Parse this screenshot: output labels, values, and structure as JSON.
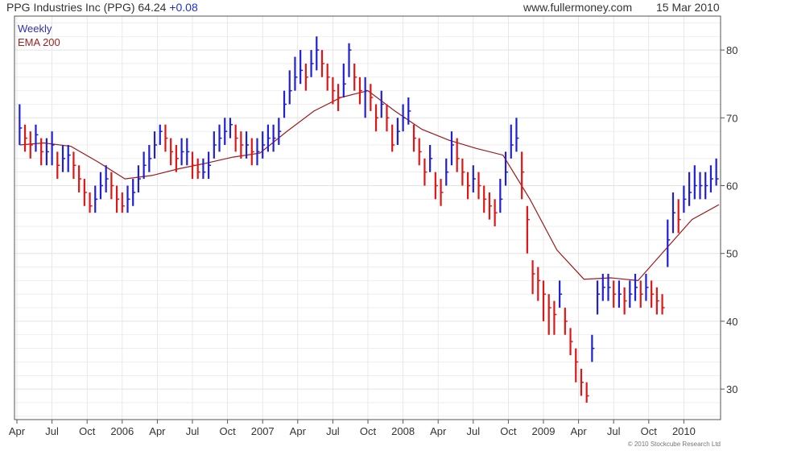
{
  "header": {
    "title": "PPG Industries Inc (PPG)",
    "last": "64.24",
    "change": "+0.08",
    "site": "www.fullermoney.com",
    "date": "15 Mar 2010"
  },
  "colors": {
    "up": "#1f1fd6",
    "down": "#e01616",
    "ema": "#9e1a1a",
    "grid": "#e3e3e3",
    "axis": "#555555"
  },
  "chart_data": {
    "type": "line",
    "title": "PPG Industries Inc (PPG)",
    "ylim": [
      25.5,
      85
    ],
    "y_ticks": [
      30,
      40,
      50,
      60,
      70,
      80
    ],
    "x_ticks": [
      "Apr",
      "Jul",
      "Oct",
      "2006",
      "Apr",
      "Jul",
      "Oct",
      "2007",
      "Apr",
      "Jul",
      "Oct",
      "2008",
      "Apr",
      "Jul",
      "Oct",
      "2009",
      "Apr",
      "Jul",
      "Oct",
      "2010"
    ],
    "grid": true,
    "legend": [
      "Weekly",
      "EMA 200"
    ],
    "legend_position": "top-left",
    "series": [
      {
        "name": "Weekly",
        "kind": "price-bars",
        "x": [
          1,
          3,
          5,
          7,
          9,
          11,
          13,
          15,
          17,
          19,
          21,
          23,
          25,
          27,
          29,
          31,
          33,
          35,
          37,
          39,
          41,
          43,
          45,
          47,
          49,
          51,
          53,
          55,
          57,
          59,
          61,
          63,
          65,
          67,
          69,
          71,
          73,
          75,
          77,
          79,
          81,
          83,
          85,
          87,
          89,
          91,
          93,
          95,
          97,
          99,
          101,
          103,
          105,
          107,
          109,
          111,
          113,
          115,
          117,
          119,
          121,
          123,
          125,
          127,
          129,
          131,
          133,
          135,
          137,
          139,
          141,
          143,
          145,
          147,
          149,
          151,
          153,
          155,
          157,
          159,
          161,
          163,
          165,
          167,
          169,
          171,
          173,
          175,
          177,
          179,
          181,
          183,
          185,
          187,
          189,
          191,
          193,
          195,
          197,
          199,
          201,
          203,
          205,
          207,
          209,
          211,
          213,
          215,
          217,
          219,
          221,
          223,
          225,
          227,
          229,
          231,
          233,
          235,
          237,
          239,
          241,
          243,
          245,
          247,
          249,
          251,
          253,
          255,
          257,
          259
        ],
        "values": [
          68.5,
          67,
          66,
          67.5,
          65,
          65,
          66,
          63,
          64,
          64.5,
          63,
          61,
          59,
          57,
          58,
          60,
          61,
          60,
          58,
          57,
          58,
          59,
          61,
          63,
          64,
          66,
          68,
          67,
          65,
          64,
          65,
          65,
          63,
          62,
          62,
          63,
          66,
          67,
          68,
          69,
          67,
          66,
          66,
          65,
          65,
          66,
          67,
          67,
          68,
          72,
          74,
          76,
          77,
          76,
          78,
          80,
          78,
          76,
          74,
          73,
          75,
          80,
          76,
          74,
          74,
          73,
          70,
          72,
          70,
          66,
          68,
          70,
          71,
          67,
          65,
          62,
          64,
          60,
          59,
          62,
          66,
          64,
          62,
          60,
          61,
          60,
          58,
          57,
          56,
          58,
          62,
          66,
          67,
          62,
          55,
          47,
          46,
          44,
          42,
          41,
          44,
          40,
          37,
          34,
          31,
          29,
          36,
          44,
          45,
          45,
          44,
          44,
          43,
          44,
          45,
          44,
          45,
          44,
          43,
          42,
          52,
          56,
          55,
          58,
          59,
          60,
          60,
          60,
          61,
          61
        ],
        "high": [
          72,
          69,
          68,
          69,
          67,
          67,
          68,
          65,
          66,
          66,
          65,
          63,
          61,
          59,
          60,
          62,
          63,
          62,
          60,
          59,
          60,
          61,
          63,
          65,
          66,
          68,
          69,
          69,
          67,
          66,
          67,
          67,
          65,
          64,
          64,
          65,
          68,
          69,
          70,
          70,
          69,
          68,
          68,
          67,
          67,
          68,
          69,
          69,
          70,
          74,
          77,
          79,
          80,
          78,
          80,
          82,
          80,
          78,
          76,
          75,
          78,
          81,
          78,
          76,
          76,
          75,
          72,
          74,
          72,
          69,
          70,
          72,
          73,
          69,
          67,
          64,
          66,
          62,
          61,
          64,
          68,
          67,
          64,
          62,
          63,
          62,
          60,
          59,
          58,
          61,
          65,
          69,
          70,
          65,
          57,
          49,
          48,
          46,
          44,
          43,
          46,
          42,
          39,
          36,
          33,
          31,
          38,
          46,
          47,
          47,
          46,
          46,
          45,
          46,
          47,
          46,
          47,
          46,
          45,
          44,
          55,
          59,
          58,
          60,
          62,
          63,
          62,
          62,
          63,
          64
        ],
        "low": [
          66,
          65,
          64,
          65,
          63,
          63,
          63,
          61,
          62,
          62,
          61,
          59,
          57,
          56,
          56,
          58,
          59,
          58,
          56,
          56,
          56,
          57,
          59,
          61,
          62,
          64,
          66,
          65,
          63,
          62,
          63,
          63,
          61,
          61,
          61,
          61,
          64,
          65,
          66,
          67,
          65,
          64,
          64,
          63,
          63,
          64,
          65,
          65,
          66,
          70,
          72,
          74,
          75,
          74,
          76,
          77,
          76,
          74,
          72,
          71,
          73,
          76,
          74,
          72,
          70,
          71,
          68,
          70,
          68,
          65,
          66,
          68,
          69,
          65,
          63,
          60,
          62,
          58,
          57,
          60,
          63,
          62,
          60,
          58,
          59,
          58,
          56,
          55,
          54,
          56,
          60,
          64,
          65,
          58,
          50,
          44,
          43,
          40,
          38,
          38,
          42,
          38,
          35,
          31,
          29,
          28,
          34,
          41,
          43,
          43,
          42,
          42,
          41,
          42,
          43,
          42,
          43,
          42,
          41,
          41,
          48,
          53,
          53,
          56,
          57,
          58,
          58,
          58,
          59,
          60
        ]
      },
      {
        "name": "EMA 200",
        "kind": "line",
        "x": [
          1,
          10,
          20,
          30,
          40,
          50,
          60,
          70,
          80,
          90,
          100,
          110,
          120,
          130,
          140,
          150,
          160,
          170,
          180,
          190,
          200,
          210,
          220,
          230,
          240,
          250,
          260
        ],
        "values": [
          66,
          66.3,
          65.8,
          63.5,
          61,
          61.5,
          62.5,
          63.3,
          64.2,
          64.8,
          68,
          71,
          73,
          74,
          71,
          68.3,
          66.7,
          65.5,
          64.5,
          58,
          50.5,
          46.2,
          46.4,
          46,
          50.5,
          55,
          57.2
        ]
      }
    ]
  },
  "copyright": "© 2010 Stockcube Research Ltd"
}
